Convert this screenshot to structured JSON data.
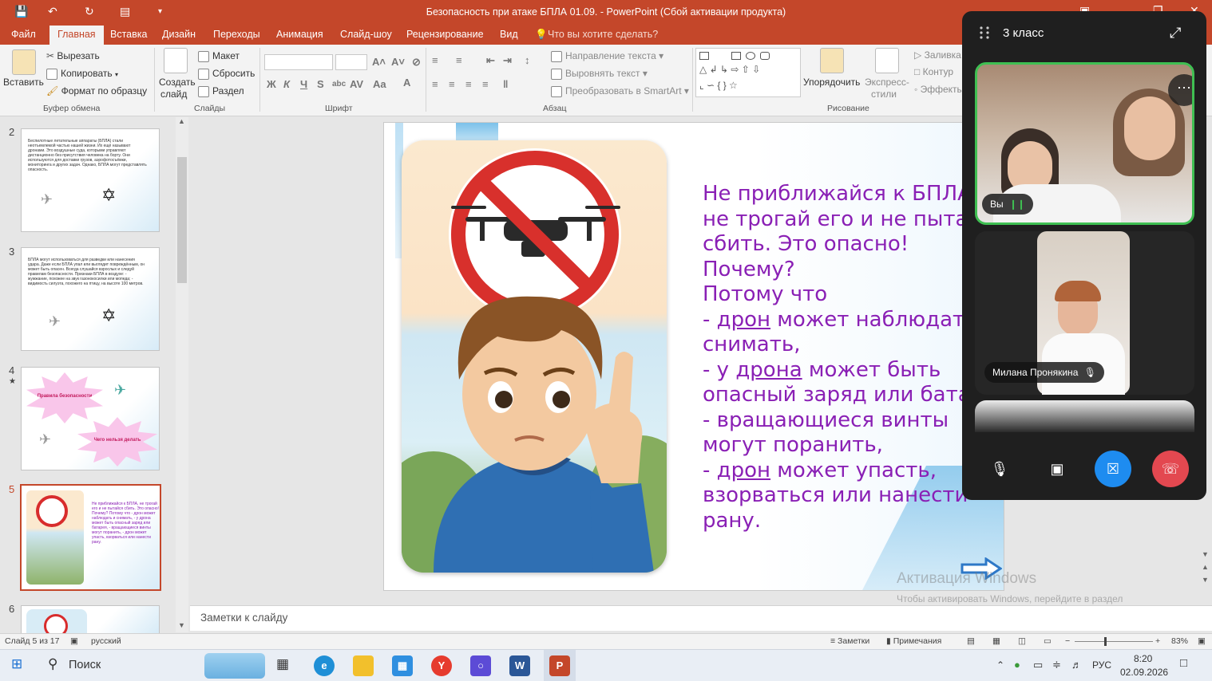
{
  "window": {
    "title": "Безопасность при атаке БПЛА 01.09. - PowerPoint (Сбой активации продукта)"
  },
  "ribbon_tabs": [
    "Файл",
    "Главная",
    "Вставка",
    "Дизайн",
    "Переходы",
    "Анимация",
    "Слайд-шоу",
    "Рецензирование",
    "Вид"
  ],
  "tell_me": "Что вы хотите сделать?",
  "clipboard": {
    "paste": "Вставить",
    "cut": "Вырезать",
    "copy": "Копировать",
    "format_painter": "Формат по образцу",
    "group": "Буфер обмена"
  },
  "slides_group": {
    "new_slide_1": "Создать",
    "new_slide_2": "слайд",
    "layout": "Макет",
    "reset": "Сбросить",
    "section": "Раздел",
    "group": "Слайды"
  },
  "font_group": {
    "group": "Шрифт",
    "bold": "Ж",
    "italic": "К",
    "underline": "Ч",
    "shadow": "S"
  },
  "paragraph_group": {
    "text_direction": "Направление текста",
    "align_text": "Выровнять текст",
    "smartart": "Преобразовать в SmartArt",
    "group": "Абзац"
  },
  "drawing_group": {
    "arrange": "Упорядочить",
    "express_1": "Экспресс-",
    "express_2": "стили",
    "fill": "Заливка",
    "outline": "Контур",
    "effects": "Эффекты",
    "group": "Рисование"
  },
  "thumbnails": {
    "numbers": [
      "2",
      "3",
      "4",
      "5",
      "6"
    ],
    "slide2_text": "Беспилотные летательные аппараты (БПЛА) стали неотъемлемой частью нашей жизни. Их ещё называют дронами. Это воздушные суда, которыми управляют дистанционно без присутствия человека на борту. Они используются для доставки грузов, аэрофотосъёмки, мониторинга и других задач. Однако, БПЛА могут представлять опасность.",
    "slide3_text": "БПЛА могут использоваться для разведки или нанесения удара. Даже если БПЛА упал или выглядит повреждённым, он может быть опасен. Всегда слушайся взрослых и следуй правилам безопасности. Признаки БПЛА в воздухе: - жужжание, похожее на звук газонокосилки или мопеда; - видимость силуэта, похожего на птицу, на высоте 100 метров.",
    "slide4_burst1": "Правила безопасности",
    "slide4_burst2": "Чего нельзя делать",
    "slide5_text": "Не приближайся к БПЛА, не трогай его и не пытайся сбить. Это опасно! Почему? Потому что - дрон может наблюдать и снимать, - у дрона может быть опасный заряд или батарея, - вращающиеся винты могут поранить, - дрон может упасть, взорваться или нанести рану."
  },
  "slide": {
    "lines": [
      "Не приближайся к БПЛА,",
      "не трогай его и не пытайся",
      "сбить. Это опасно!",
      "Почему?",
      "Потому что",
      "- дрон может наблюдать и",
      "снимать,",
      "- у дрона может быть",
      "опасный заряд или батарея,",
      "- вращающиеся винты",
      "могут поранить,",
      "- дрон может упасть,",
      "взорваться или нанести",
      "рану."
    ]
  },
  "notes_placeholder": "Заметки к слайду",
  "status": {
    "slide_count": "Слайд 5 из 17",
    "language": "русский",
    "notes": "Заметки",
    "comments": "Примечания",
    "zoom": "83%"
  },
  "watermark": {
    "line1": "Активация Windows",
    "line2": "Чтобы активировать Windows, перейдите в раздел \"Параметры\"."
  },
  "call": {
    "title": "3 класс",
    "self_label": "Вы",
    "participant": "Милана Пронякина"
  },
  "taskbar": {
    "search": "Поиск",
    "lang": "РУС",
    "time": "8:20",
    "date": "02.09.2026"
  },
  "colors": {
    "ppt_accent": "#c4472a",
    "slide_text": "#8a20b5",
    "call_green": "#3fbf52",
    "call_red": "#e34850",
    "call_blue": "#1e8cf0"
  }
}
